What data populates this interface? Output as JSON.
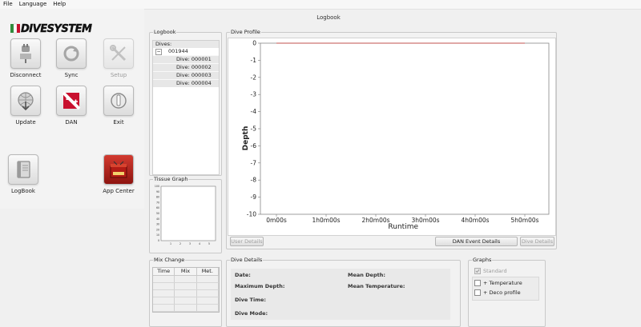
{
  "menu": [
    "File",
    "Language",
    "Help"
  ],
  "window_title": "Logbook",
  "logo_text": "DIVESYSTEM",
  "tools": {
    "disconnect": "Disconnect",
    "sync": "Sync",
    "setup": "Setup",
    "update": "Update",
    "dan": "DAN",
    "exit": "Exit",
    "logbook": "LogBook",
    "app_center": "App Center"
  },
  "logbook": {
    "title": "Logbook",
    "root_label": "Dives:",
    "device": "001944",
    "toggle": "−",
    "dives": [
      "Dive: 000001",
      "Dive: 000002",
      "Dive: 000003",
      "Dive: 000004"
    ]
  },
  "tissue_graph": {
    "title": "Tissue Graph",
    "y_ticks": [
      "100",
      "90",
      "80",
      "70",
      "60",
      "50",
      "40",
      "30",
      "20",
      "10",
      "0"
    ],
    "x_ticks": [
      "1",
      "2",
      "3",
      "4",
      "5"
    ]
  },
  "mix_change": {
    "title": "Mix Change",
    "columns": [
      "Time",
      "Mix",
      "Met."
    ]
  },
  "dive_profile": {
    "title": "Dive Profile",
    "user_details": "User Details",
    "dan_event_details": "DAN Event Details",
    "dive_details_btn": "Dive Details"
  },
  "chart_data": {
    "type": "line",
    "title": "",
    "xlabel": "Runtime",
    "ylabel": "Depth",
    "x_ticks": [
      "0m00s",
      "1h0m00s",
      "2h0m00s",
      "3h0m00s",
      "4h0m00s",
      "5h0m00s"
    ],
    "y_ticks": [
      "0",
      "-1",
      "-2",
      "-3",
      "-4",
      "-5",
      "-6",
      "-7",
      "-8",
      "-9",
      "-10"
    ],
    "ylim": [
      -10,
      0
    ],
    "series": [
      {
        "x": [
          "0m00s",
          "5h0m00s"
        ],
        "values": [
          0,
          0
        ],
        "color": "#c0504d"
      }
    ],
    "grid": false
  },
  "dive_details": {
    "title": "Dive Details",
    "date": "Date:",
    "max_depth": "Maximum Depth:",
    "dive_time": "Dive Time:",
    "dive_mode": "Dive Mode:",
    "mean_depth": "Mean Depth:",
    "mean_temp": "Mean Temperature:"
  },
  "graphs": {
    "title": "Graphs",
    "standard": "Standard",
    "temperature": "+ Temperature",
    "deco": "+ Deco profile"
  },
  "colors": {
    "accent_red": "#c8102e",
    "profile_line": "#c0504d"
  }
}
